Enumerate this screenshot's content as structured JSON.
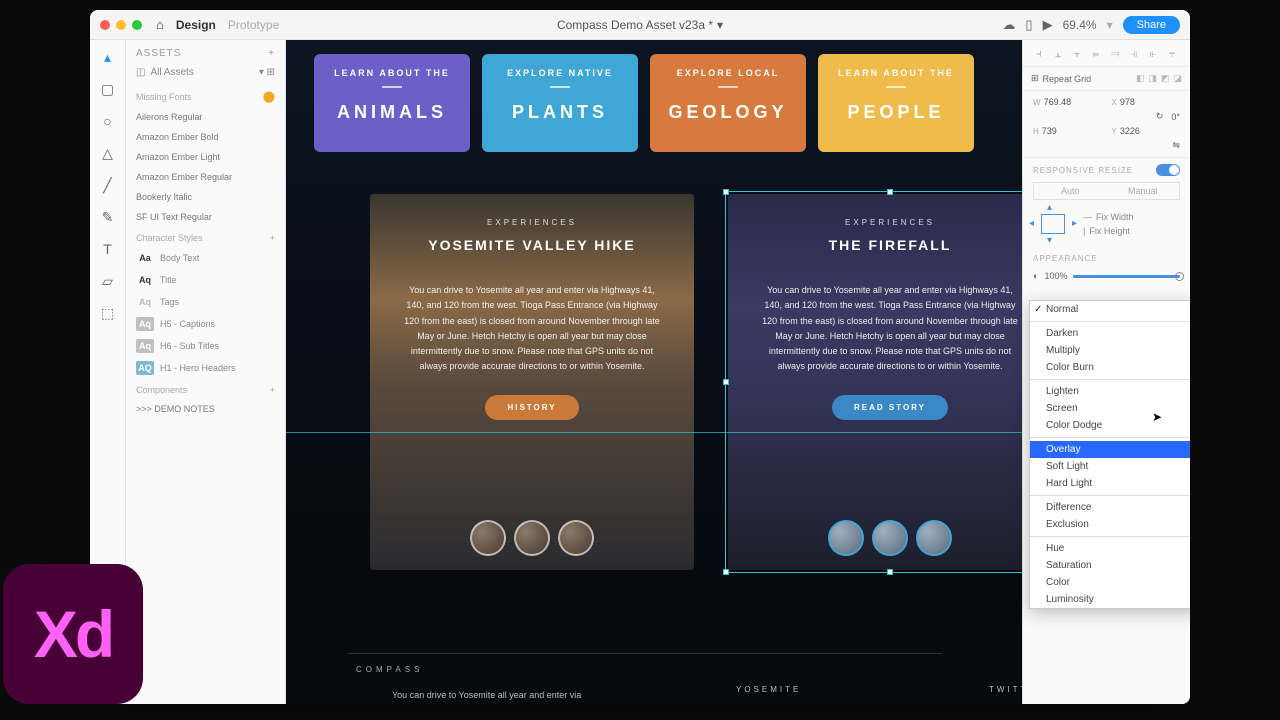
{
  "topbar": {
    "tab1": "Design",
    "tab2": "Prototype",
    "title": "Compass Demo Asset v23a *",
    "zoom": "69.4%",
    "share": "Share"
  },
  "assets": {
    "header": "ASSETS",
    "filter": "All Assets",
    "missing": "Missing Fonts",
    "fonts": [
      "Ailerons Regular",
      "Amazon Ember Bold",
      "Amazon Ember Light",
      "Amazon Ember Regular",
      "Bookerly Italic",
      "SF UI Text Regular"
    ],
    "cstyles": "Character Styles",
    "cs": [
      {
        "l": "Aa",
        "t": "Body Text",
        "c": "#333",
        "b": "transparent"
      },
      {
        "l": "Aq",
        "t": "Title",
        "c": "#333",
        "b": "transparent",
        "bold": true
      },
      {
        "l": "Aq",
        "t": "Tags",
        "c": "#bbb",
        "b": "transparent"
      },
      {
        "l": "Aq",
        "t": "H5 - Captions",
        "c": "#fff",
        "b": "#c0c0c0"
      },
      {
        "l": "Aq",
        "t": "H6 - Sub Titles",
        "c": "#fff",
        "b": "#c0c0c0"
      },
      {
        "l": "AQ",
        "t": "H1 - Hero Headers",
        "c": "#fff",
        "b": "#7fb8d4"
      }
    ],
    "components": "Components",
    "demo": ">>> DEMO NOTES"
  },
  "cards": [
    {
      "s": "LEARN ABOUT THE",
      "b": "ANIMALS"
    },
    {
      "s": "EXPLORE NATIVE",
      "b": "PLANTS"
    },
    {
      "s": "EXPLORE LOCAL",
      "b": "GEOLOGY"
    },
    {
      "s": "LEARN ABOUT THE",
      "b": "PEOPLE"
    }
  ],
  "exp": {
    "lbl": "EXPERIENCES",
    "t1": "YOSEMITE VALLEY HIKE",
    "t2": "THE FIREFALL",
    "body": "You can drive to Yosemite all year and enter via Highways 41, 140, and 120 from the west. Tioga Pass Entrance (via Highway 120 from the east) is closed from around November through late May or June. Hetch Hetchy is open all year but may close intermittently due to snow. Please note that GPS units do not always provide accurate directions to or within Yosemite.",
    "btn1": "HISTORY",
    "btn2": "READ STORY"
  },
  "foot": {
    "brand": "COMPASS",
    "text": "You can drive to Yosemite all year and enter via",
    "n1": "YOSEMITE",
    "n2": "TWITTER"
  },
  "props": {
    "rg": "Repeat Grid",
    "w": "769.48",
    "x": "978",
    "rot": "0°",
    "h": "739",
    "y": "3226",
    "rr": "RESPONSIVE RESIZE",
    "auto": "Auto",
    "manual": "Manual",
    "fw": "Fix Width",
    "fh": "Fix Height",
    "app": "APPEARANCE",
    "opc": "100%"
  },
  "blend": {
    "items": [
      "Normal",
      "Darken",
      "Multiply",
      "Color Burn",
      "Lighten",
      "Screen",
      "Color Dodge",
      "Overlay",
      "Soft Light",
      "Hard Light",
      "Difference",
      "Exclusion",
      "Hue",
      "Saturation",
      "Color",
      "Luminosity"
    ],
    "checked": "Normal",
    "selected": "Overlay",
    "seps": [
      1,
      4,
      7,
      10,
      12
    ]
  }
}
